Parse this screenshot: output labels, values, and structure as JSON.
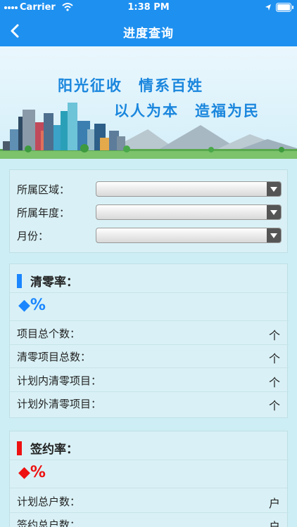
{
  "status": {
    "carrier": "Carrier",
    "time": "1:38 PM"
  },
  "nav": {
    "title": "进度查询"
  },
  "banner": {
    "line1": "阳光征收　情系百姓",
    "line2": "以人为本　造福为民"
  },
  "filters": [
    {
      "label": "所属区域："
    },
    {
      "label": "所属年度："
    },
    {
      "label": "月份："
    }
  ],
  "clearance": {
    "title": "清零率：",
    "value": "%",
    "accent": "#1a86ff",
    "rows": [
      {
        "label": "项目总个数：",
        "unit": "个"
      },
      {
        "label": "清零项目总数：",
        "unit": "个"
      },
      {
        "label": "计划内清零项目：",
        "unit": "个"
      },
      {
        "label": "计划外清零项目：",
        "unit": "个"
      }
    ]
  },
  "signing": {
    "title": "签约率：",
    "value": "%",
    "accent": "#ee1111",
    "rows": [
      {
        "label": "计划总户数：",
        "unit": "户"
      },
      {
        "label": "签约总户数：",
        "unit": "户"
      }
    ]
  }
}
